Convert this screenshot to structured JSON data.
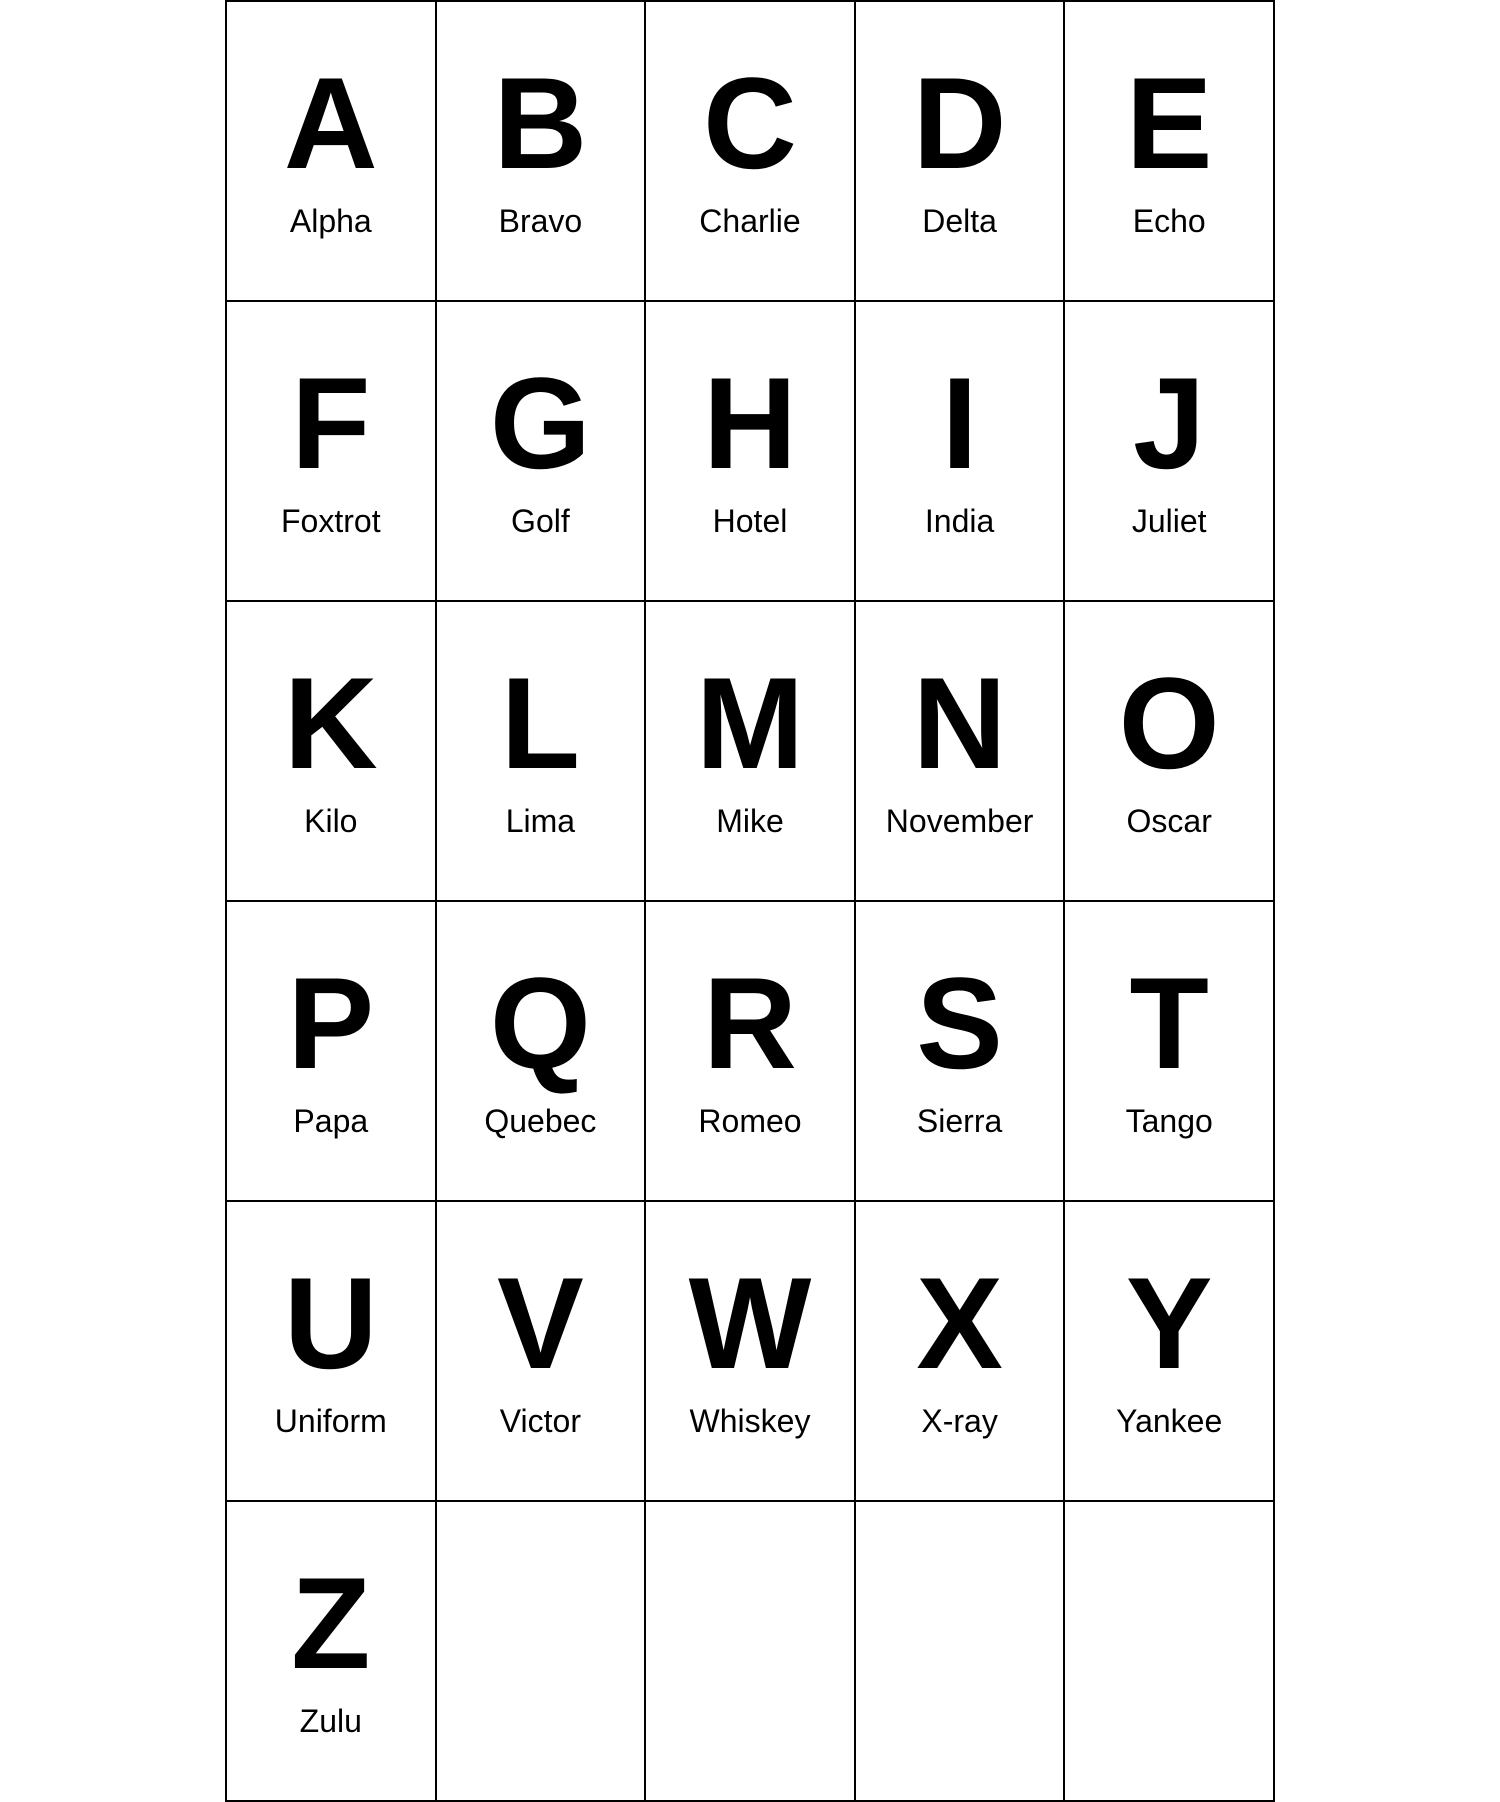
{
  "alphabet": [
    {
      "letter": "A",
      "word": "Alpha"
    },
    {
      "letter": "B",
      "word": "Bravo"
    },
    {
      "letter": "C",
      "word": "Charlie"
    },
    {
      "letter": "D",
      "word": "Delta"
    },
    {
      "letter": "E",
      "word": "Echo"
    },
    {
      "letter": "F",
      "word": "Foxtrot"
    },
    {
      "letter": "G",
      "word": "Golf"
    },
    {
      "letter": "H",
      "word": "Hotel"
    },
    {
      "letter": "I",
      "word": "India"
    },
    {
      "letter": "J",
      "word": "Juliet"
    },
    {
      "letter": "K",
      "word": "Kilo"
    },
    {
      "letter": "L",
      "word": "Lima"
    },
    {
      "letter": "M",
      "word": "Mike"
    },
    {
      "letter": "N",
      "word": "November"
    },
    {
      "letter": "O",
      "word": "Oscar"
    },
    {
      "letter": "P",
      "word": "Papa"
    },
    {
      "letter": "Q",
      "word": "Quebec"
    },
    {
      "letter": "R",
      "word": "Romeo"
    },
    {
      "letter": "S",
      "word": "Sierra"
    },
    {
      "letter": "T",
      "word": "Tango"
    },
    {
      "letter": "U",
      "word": "Uniform"
    },
    {
      "letter": "V",
      "word": "Victor"
    },
    {
      "letter": "W",
      "word": "Whiskey"
    },
    {
      "letter": "X",
      "word": "X-ray"
    },
    {
      "letter": "Y",
      "word": "Yankee"
    },
    {
      "letter": "Z",
      "word": "Zulu"
    }
  ],
  "empty_cells": 4
}
